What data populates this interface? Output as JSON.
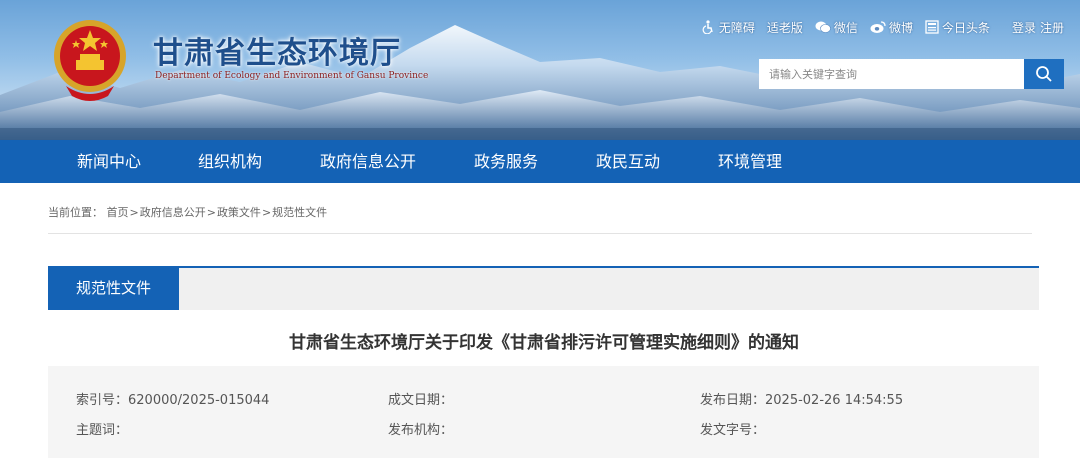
{
  "header": {
    "site_title": "甘肃省生态环境厅",
    "site_subtitle": "Department of Ecology and Environment of Gansu Province",
    "toplinks": {
      "accessibility": "无障碍",
      "elderly": "适老版",
      "wechat": "微信",
      "weibo": "微博",
      "toutiao": "今日头条",
      "login": "登录",
      "register": "注册"
    },
    "search": {
      "placeholder": "请输入关键字查询"
    }
  },
  "nav": {
    "items": [
      "新闻中心",
      "组织机构",
      "政府信息公开",
      "政务服务",
      "政民互动",
      "环境管理"
    ]
  },
  "breadcrumb": {
    "prefix": "当前位置：",
    "items": [
      "首页",
      "政府信息公开",
      "政策文件",
      "规范性文件"
    ],
    "separator": ">"
  },
  "section": {
    "tab_label": "规范性文件"
  },
  "article": {
    "title": "甘肃省生态环境厅关于印发《甘肃省排污许可管理实施细则》的通知",
    "meta": {
      "index_label": "索引号：",
      "index_value": "620000/2025-015044",
      "created_label": "成文日期：",
      "created_value": "",
      "published_label": "发布日期：",
      "published_value": "2025-02-26 14:54:55",
      "subject_label": "主题词：",
      "subject_value": "",
      "issuer_label": "发布机构：",
      "issuer_value": "",
      "docno_label": "发文字号：",
      "docno_value": ""
    }
  },
  "colors": {
    "nav_blue": "#1462b5",
    "title_blue": "#1f4f8c",
    "search_button": "#1f6fc0"
  },
  "icons": [
    "national-emblem-icon",
    "accessibility-icon",
    "elderly-icon",
    "wechat-icon",
    "weibo-icon",
    "toutiao-icon",
    "search-icon"
  ]
}
